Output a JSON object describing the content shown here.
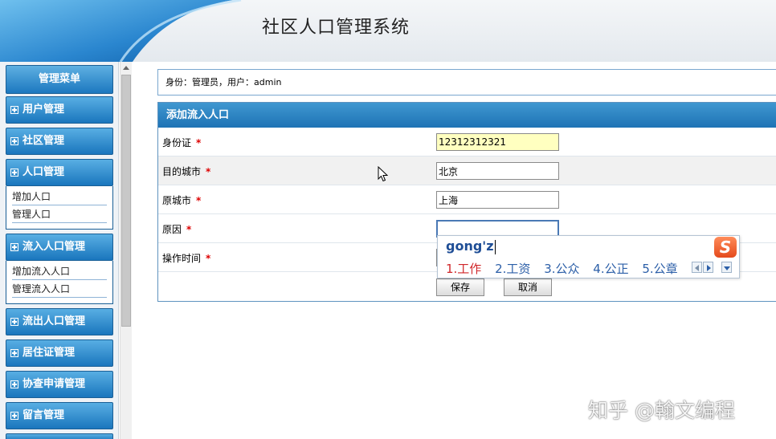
{
  "header": {
    "title": "社区人口管理系统"
  },
  "sidebar": {
    "menu_title": "管理菜单",
    "items": [
      {
        "label": "用户管理"
      },
      {
        "label": "社区管理"
      },
      {
        "label": "人口管理",
        "children": [
          "增加人口",
          "管理人口"
        ]
      },
      {
        "label": "流入人口管理",
        "children": [
          "增加流入人口",
          "管理流入人口"
        ]
      },
      {
        "label": "流出人口管理"
      },
      {
        "label": "居住证管理"
      },
      {
        "label": "协查申请管理"
      },
      {
        "label": "留言管理"
      }
    ]
  },
  "identity": {
    "text": "身份：管理员，用户：admin"
  },
  "form": {
    "title": "添加流入人口",
    "required_mark": "*",
    "fields": [
      {
        "label": "身份证",
        "value": "12312312321"
      },
      {
        "label": "目的城市",
        "value": "北京"
      },
      {
        "label": "原城市",
        "value": "上海"
      },
      {
        "label": "原因",
        "value": ""
      },
      {
        "label": "操作时间",
        "value": ""
      }
    ],
    "save_label": "保存",
    "cancel_label": "取消"
  },
  "ime": {
    "pinyin": "gong'z",
    "logo": "S",
    "candidates": [
      "1.工作",
      "2.工资",
      "3.公众",
      "4.公正",
      "5.公章"
    ]
  },
  "watermark": {
    "text": "知乎 @翰文编程"
  },
  "colors": {
    "accent_blue": "#1e73b5",
    "required_red": "#dd0000",
    "ime_highlight": "#d0272a"
  }
}
